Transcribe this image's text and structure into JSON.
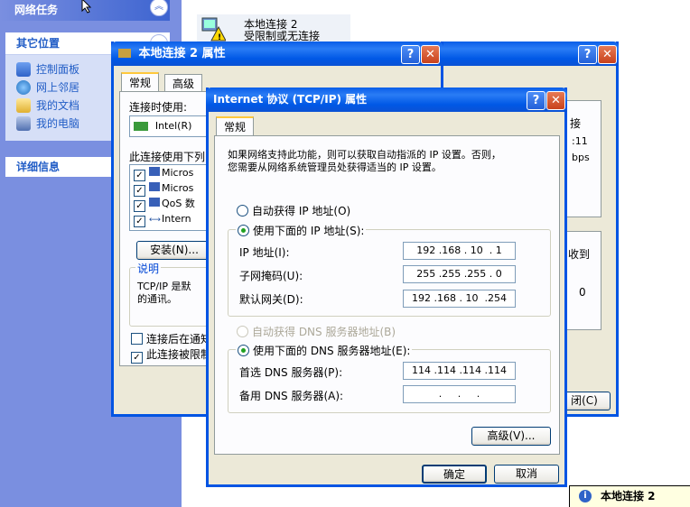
{
  "taskpane": {
    "network_tasks_title": "网络任务",
    "other_places_title": "其它位置",
    "other_places": [
      "控制面板",
      "网上邻居",
      "我的文档",
      "我的电脑"
    ],
    "details_title": "详细信息"
  },
  "explorer_item": {
    "name": "本地连接 2",
    "status": "受限制或无连接"
  },
  "back_window": {
    "partial_texts": [
      "接",
      ":11",
      "bps",
      "收到",
      "0",
      "闭(C)"
    ]
  },
  "properties_window": {
    "title": "本地连接 2 属性",
    "tabs": [
      "常规",
      "高级"
    ],
    "connect_using_label": "连接时使用:",
    "adapter": "Intel(R)",
    "items_label": "此连接使用下列",
    "items": [
      "Micros",
      "Micros",
      "QoS 数",
      "Intern"
    ],
    "install_button": "安装(N)...",
    "description_group": "说明",
    "description_text": [
      "TCP/IP 是默",
      "的通讯。"
    ],
    "show_icon_checkbox": "连接后在通知",
    "notify_checkbox": "此连接被限制"
  },
  "tcpip_dialog": {
    "title": "Internet 协议 (TCP/IP) 属性",
    "tab": "常规",
    "intro": [
      "如果网络支持此功能，则可以获取自动指派的 IP 设置。否则，",
      "您需要从网络系统管理员处获得适当的 IP 设置。"
    ],
    "auto_ip": "自动获得 IP 地址(O)",
    "manual_ip": "使用下面的 IP 地址(S):",
    "ip_label": "IP 地址(I):",
    "ip_value": "192 .168 . 10  . 1",
    "mask_label": "子网掩码(U):",
    "mask_value": "255 .255 .255 . 0",
    "gateway_label": "默认网关(D):",
    "gateway_value": "192 .168 . 10  .254",
    "auto_dns": "自动获得 DNS 服务器地址(B)",
    "manual_dns": "使用下面的 DNS 服务器地址(E):",
    "preferred_dns_label": "首选 DNS 服务器(P):",
    "preferred_dns_value": "114 .114 .114 .114",
    "alternate_dns_label": "备用 DNS 服务器(A):",
    "alternate_dns_value": "  .     .     .  ",
    "advanced_button": "高级(V)...",
    "ok_button": "确定",
    "cancel_button": "取消"
  },
  "tray_balloon": {
    "title": "本地连接 2"
  },
  "colors": {
    "xp_blue": "#0054e3",
    "taskpane": "#7a8fe0",
    "dialog_bg": "#ece9d8"
  }
}
